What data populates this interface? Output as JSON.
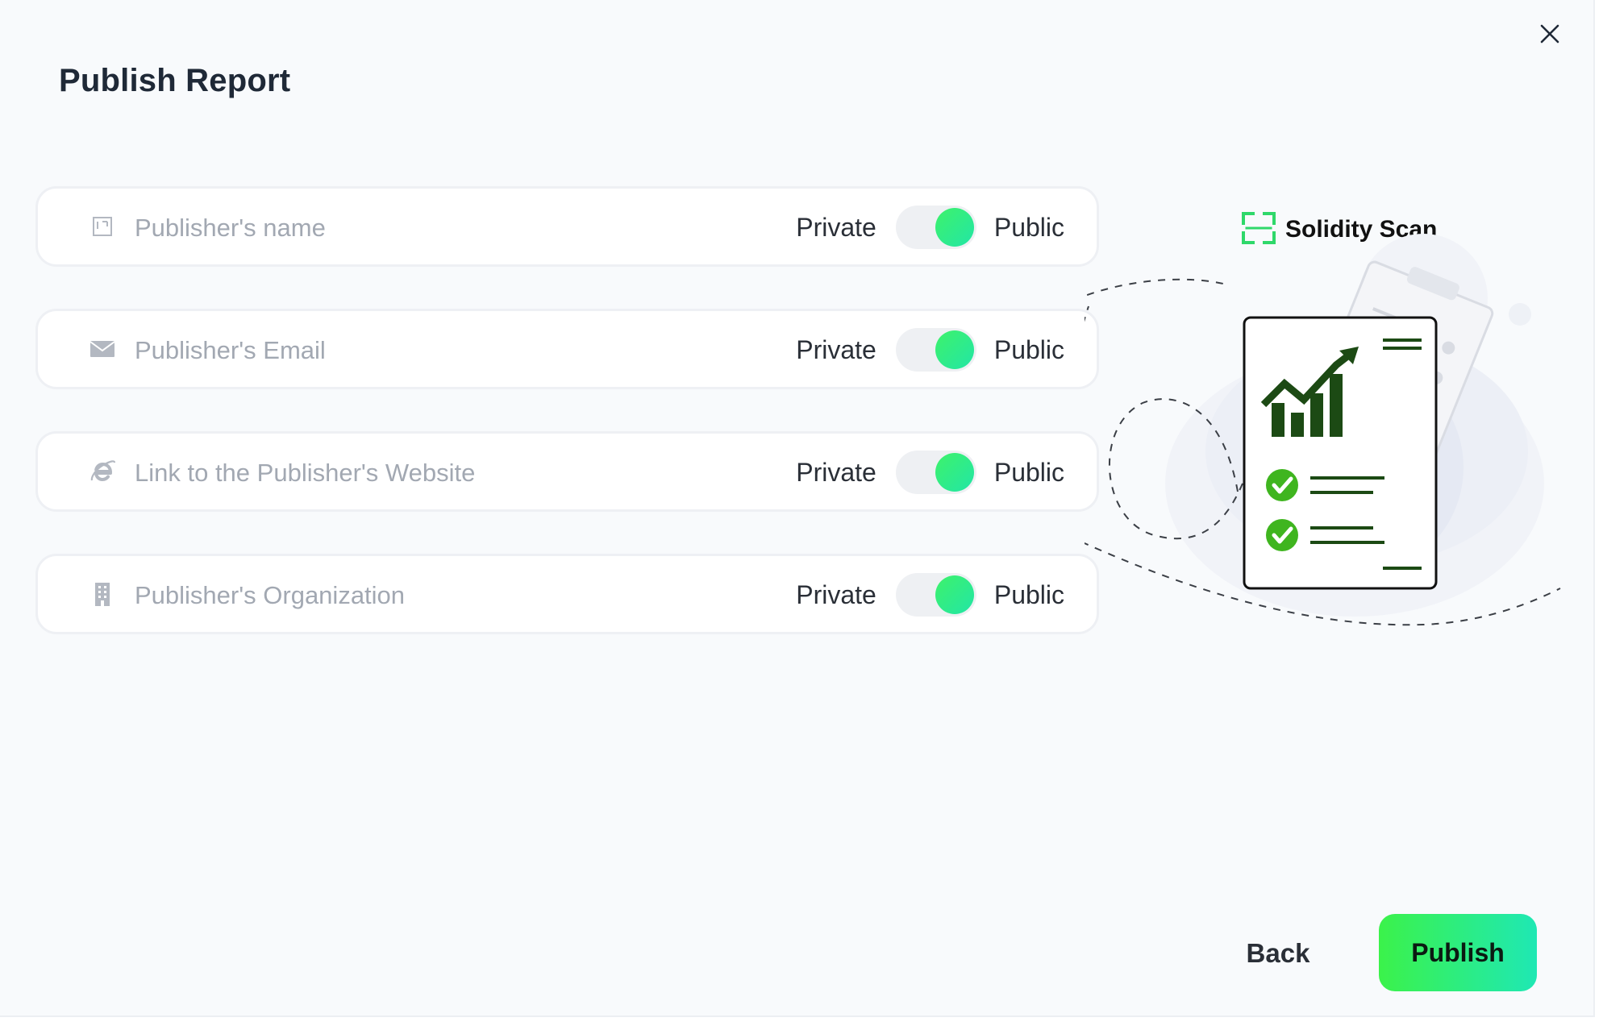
{
  "dialog": {
    "title": "Publish Report"
  },
  "fields": [
    {
      "placeholder": "Publisher's name",
      "icon": "id-card-icon",
      "private_label": "Private",
      "public_label": "Public",
      "state": "public"
    },
    {
      "placeholder": "Publisher's Email",
      "icon": "envelope-icon",
      "private_label": "Private",
      "public_label": "Public",
      "state": "public"
    },
    {
      "placeholder": "Link to the Publisher's Website",
      "icon": "browser-e-icon",
      "private_label": "Private",
      "public_label": "Public",
      "state": "public"
    },
    {
      "placeholder": "Publisher's Organization",
      "icon": "building-icon",
      "private_label": "Private",
      "public_label": "Public",
      "state": "public"
    }
  ],
  "brand": {
    "name": "Solidity Scan",
    "icon": "scan-frame-icon"
  },
  "actions": {
    "back_label": "Back",
    "publish_label": "Publish"
  },
  "colors": {
    "accent_start": "#3bf24a",
    "accent_end": "#1fe8b4",
    "chart_green": "#1c4a14",
    "check_green": "#3fb51f"
  }
}
